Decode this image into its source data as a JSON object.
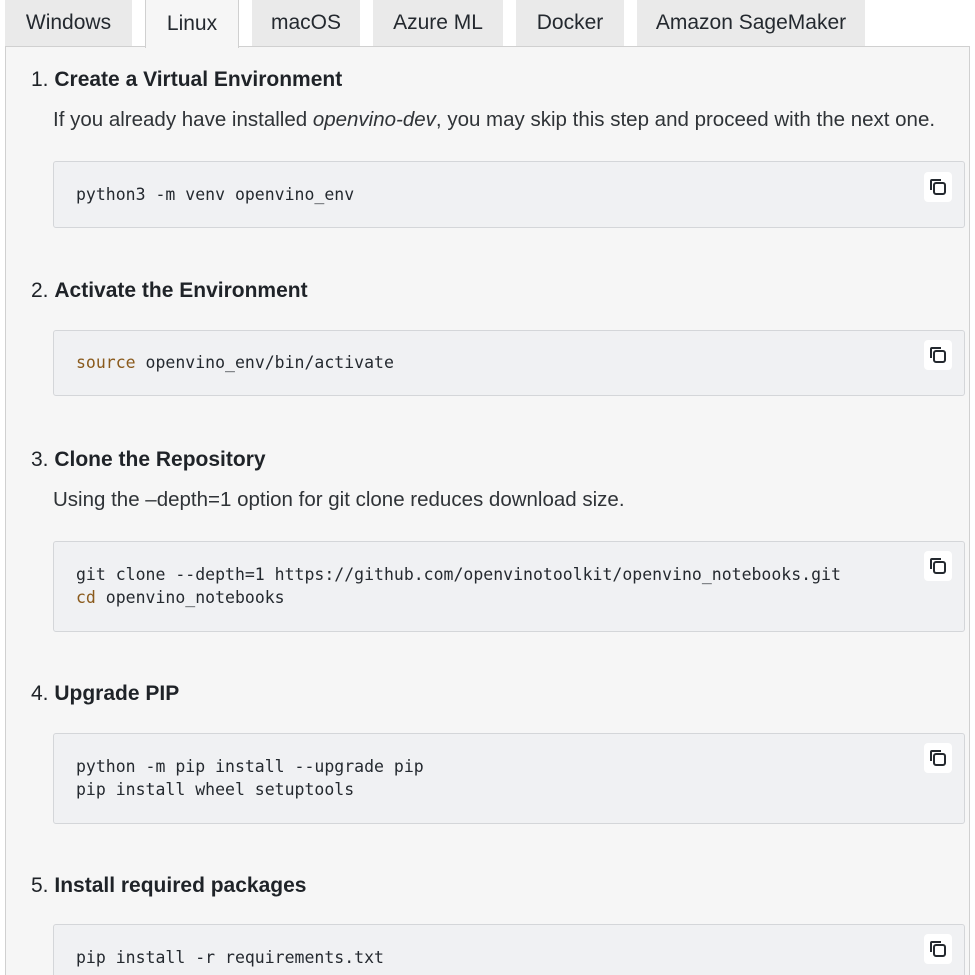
{
  "tabs": [
    {
      "label": "Windows",
      "active": false
    },
    {
      "label": "Linux",
      "active": true
    },
    {
      "label": "macOS",
      "active": false
    },
    {
      "label": "Azure ML",
      "active": false
    },
    {
      "label": "Docker",
      "active": false
    },
    {
      "label": "Amazon SageMaker",
      "active": false
    }
  ],
  "steps": [
    {
      "number": "1.",
      "title": "Create a Virtual Environment",
      "desc_before": "If you already have installed ",
      "desc_em": "openvino-dev",
      "desc_after": ", you may skip this step and proceed with the next one.",
      "code": [
        "python3 -m venv openvino_env"
      ]
    },
    {
      "number": "2.",
      "title": "Activate the Environment",
      "code_keyword": "source",
      "code_rest": " openvino_env/bin/activate"
    },
    {
      "number": "3.",
      "title": "Clone the Repository",
      "desc": "Using the –depth=1 option for git clone reduces download size.",
      "code_line1": "git clone --depth=1 https://github.com/openvinotoolkit/openvino_notebooks.git",
      "code_line2_keyword": "cd",
      "code_line2_rest": " openvino_notebooks"
    },
    {
      "number": "4.",
      "title": "Upgrade PIP",
      "code_line1": "python -m pip install --upgrade pip",
      "code_line2": "pip install wheel setuptools"
    },
    {
      "number": "5.",
      "title": "Install required packages",
      "code_line1": "pip install -r requirements.txt"
    }
  ],
  "icons": {
    "copy": "copy-icon"
  },
  "colors": {
    "panel_bg": "#f6f6f6",
    "code_bg": "#f0f1f3",
    "keyword": "#8a5a1c",
    "tab_inactive": "#eaeaea"
  }
}
